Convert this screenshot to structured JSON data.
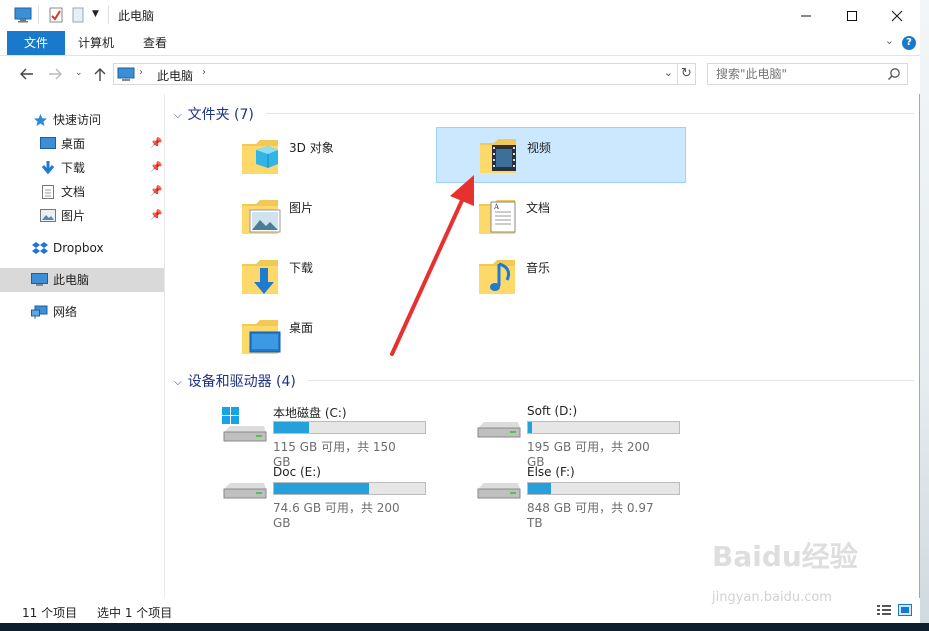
{
  "window": {
    "title": "此电脑"
  },
  "ribbon": {
    "tabs": [
      "文件",
      "计算机",
      "查看"
    ],
    "help": "?"
  },
  "address": {
    "crumb": "此电脑",
    "search_placeholder": "搜索\"此电脑\""
  },
  "nav": {
    "quick_access": "快速访问",
    "quick_items": [
      "桌面",
      "下载",
      "文档",
      "图片"
    ],
    "dropbox": "Dropbox",
    "this_pc": "此电脑",
    "network": "网络"
  },
  "folders": {
    "header": "文件夹 (7)",
    "items": [
      "3D 对象",
      "视频",
      "图片",
      "文档",
      "下载",
      "音乐",
      "桌面"
    ]
  },
  "drives": {
    "header": "设备和驱动器 (4)",
    "items": [
      {
        "name": "本地磁盘 (C:)",
        "info": "115 GB 可用，共 150 GB",
        "used_fraction": 0.23
      },
      {
        "name": "Soft (D:)",
        "info": "195 GB 可用，共 200 GB",
        "used_fraction": 0.025
      },
      {
        "name": "Doc (E:)",
        "info": "74.6 GB 可用，共 200 GB",
        "used_fraction": 0.63
      },
      {
        "name": "Else (F:)",
        "info": "848 GB 可用，共 0.97 TB",
        "used_fraction": 0.15
      }
    ]
  },
  "status": {
    "count": "11 个项目",
    "selection": "选中 1 个项目"
  },
  "watermark": {
    "brand": "Baidu经验",
    "url": "jingyan.baidu.com"
  },
  "colors": {
    "accent": "#1979ca",
    "selection": "#cce8ff",
    "drive_bar": "#26a0da",
    "arrow": "#e8312f"
  }
}
